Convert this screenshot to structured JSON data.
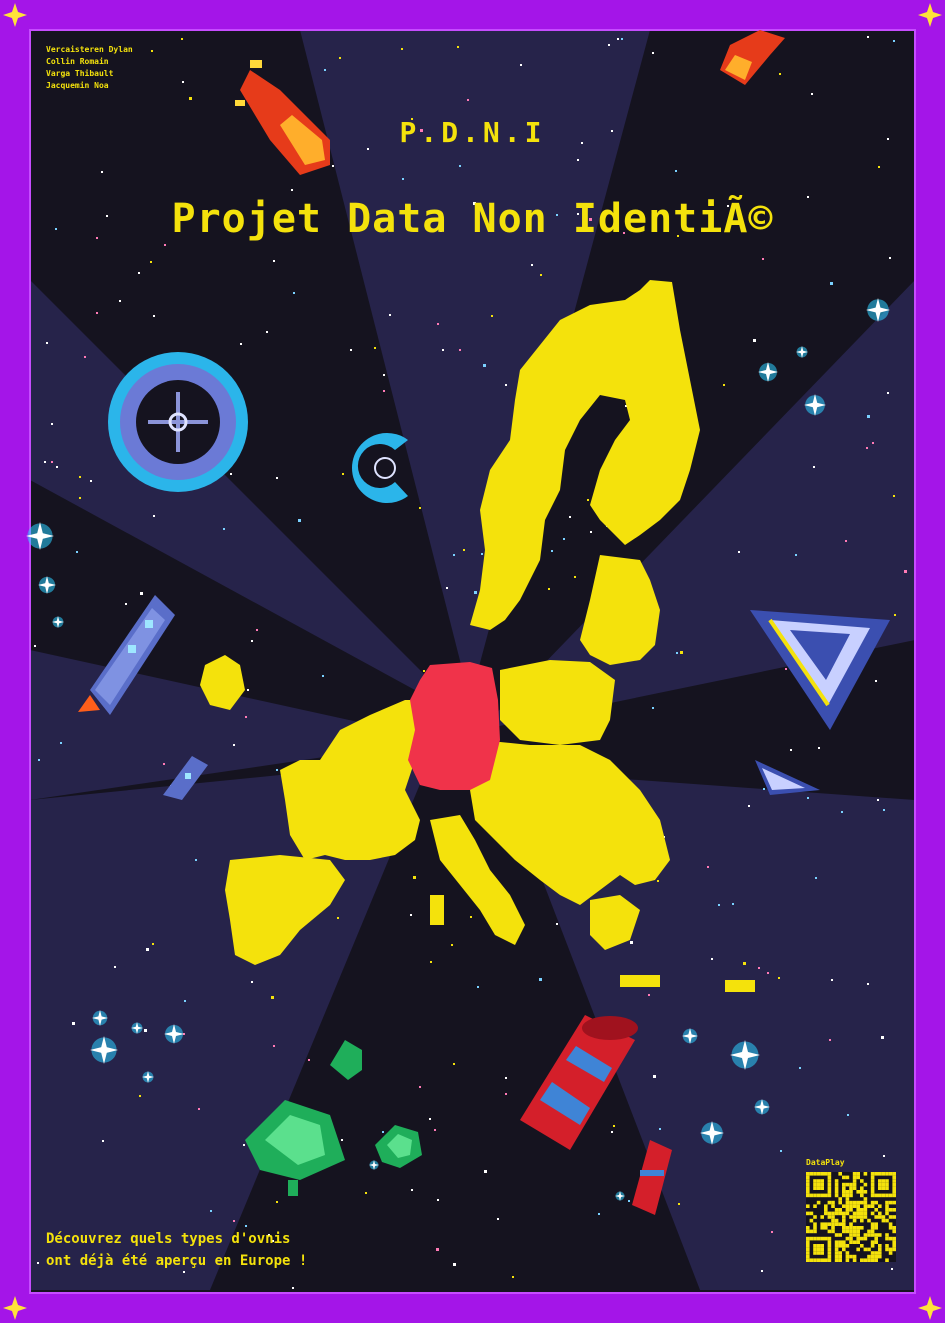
{
  "credits": [
    "Vercaisteren Dylan",
    "Collin Romain",
    "Varga Thibault",
    "Jacquemin Noa"
  ],
  "acronym": "P.D.N.I",
  "title": "Projet Data Non IdentiÃ©",
  "tagline": [
    "Découvrez quels types d'ovnis",
    "ont déjà été aperçu en Europe !"
  ],
  "brand": "DataPlay",
  "colors": {
    "frame": "#a415e8",
    "space_dark": "#15131f",
    "space_light": "#26234a",
    "map_yellow": "#f4e20c",
    "highlight_red": "#f0334a",
    "text_yellow": "#f4e20c"
  },
  "icons": [
    "meteor-icon",
    "ring-station-icon",
    "rocket-icon",
    "triangle-ship-icon",
    "red-capsule-icon",
    "green-alien-ship-icon",
    "sparkle-star-icon",
    "qr-code-icon"
  ]
}
